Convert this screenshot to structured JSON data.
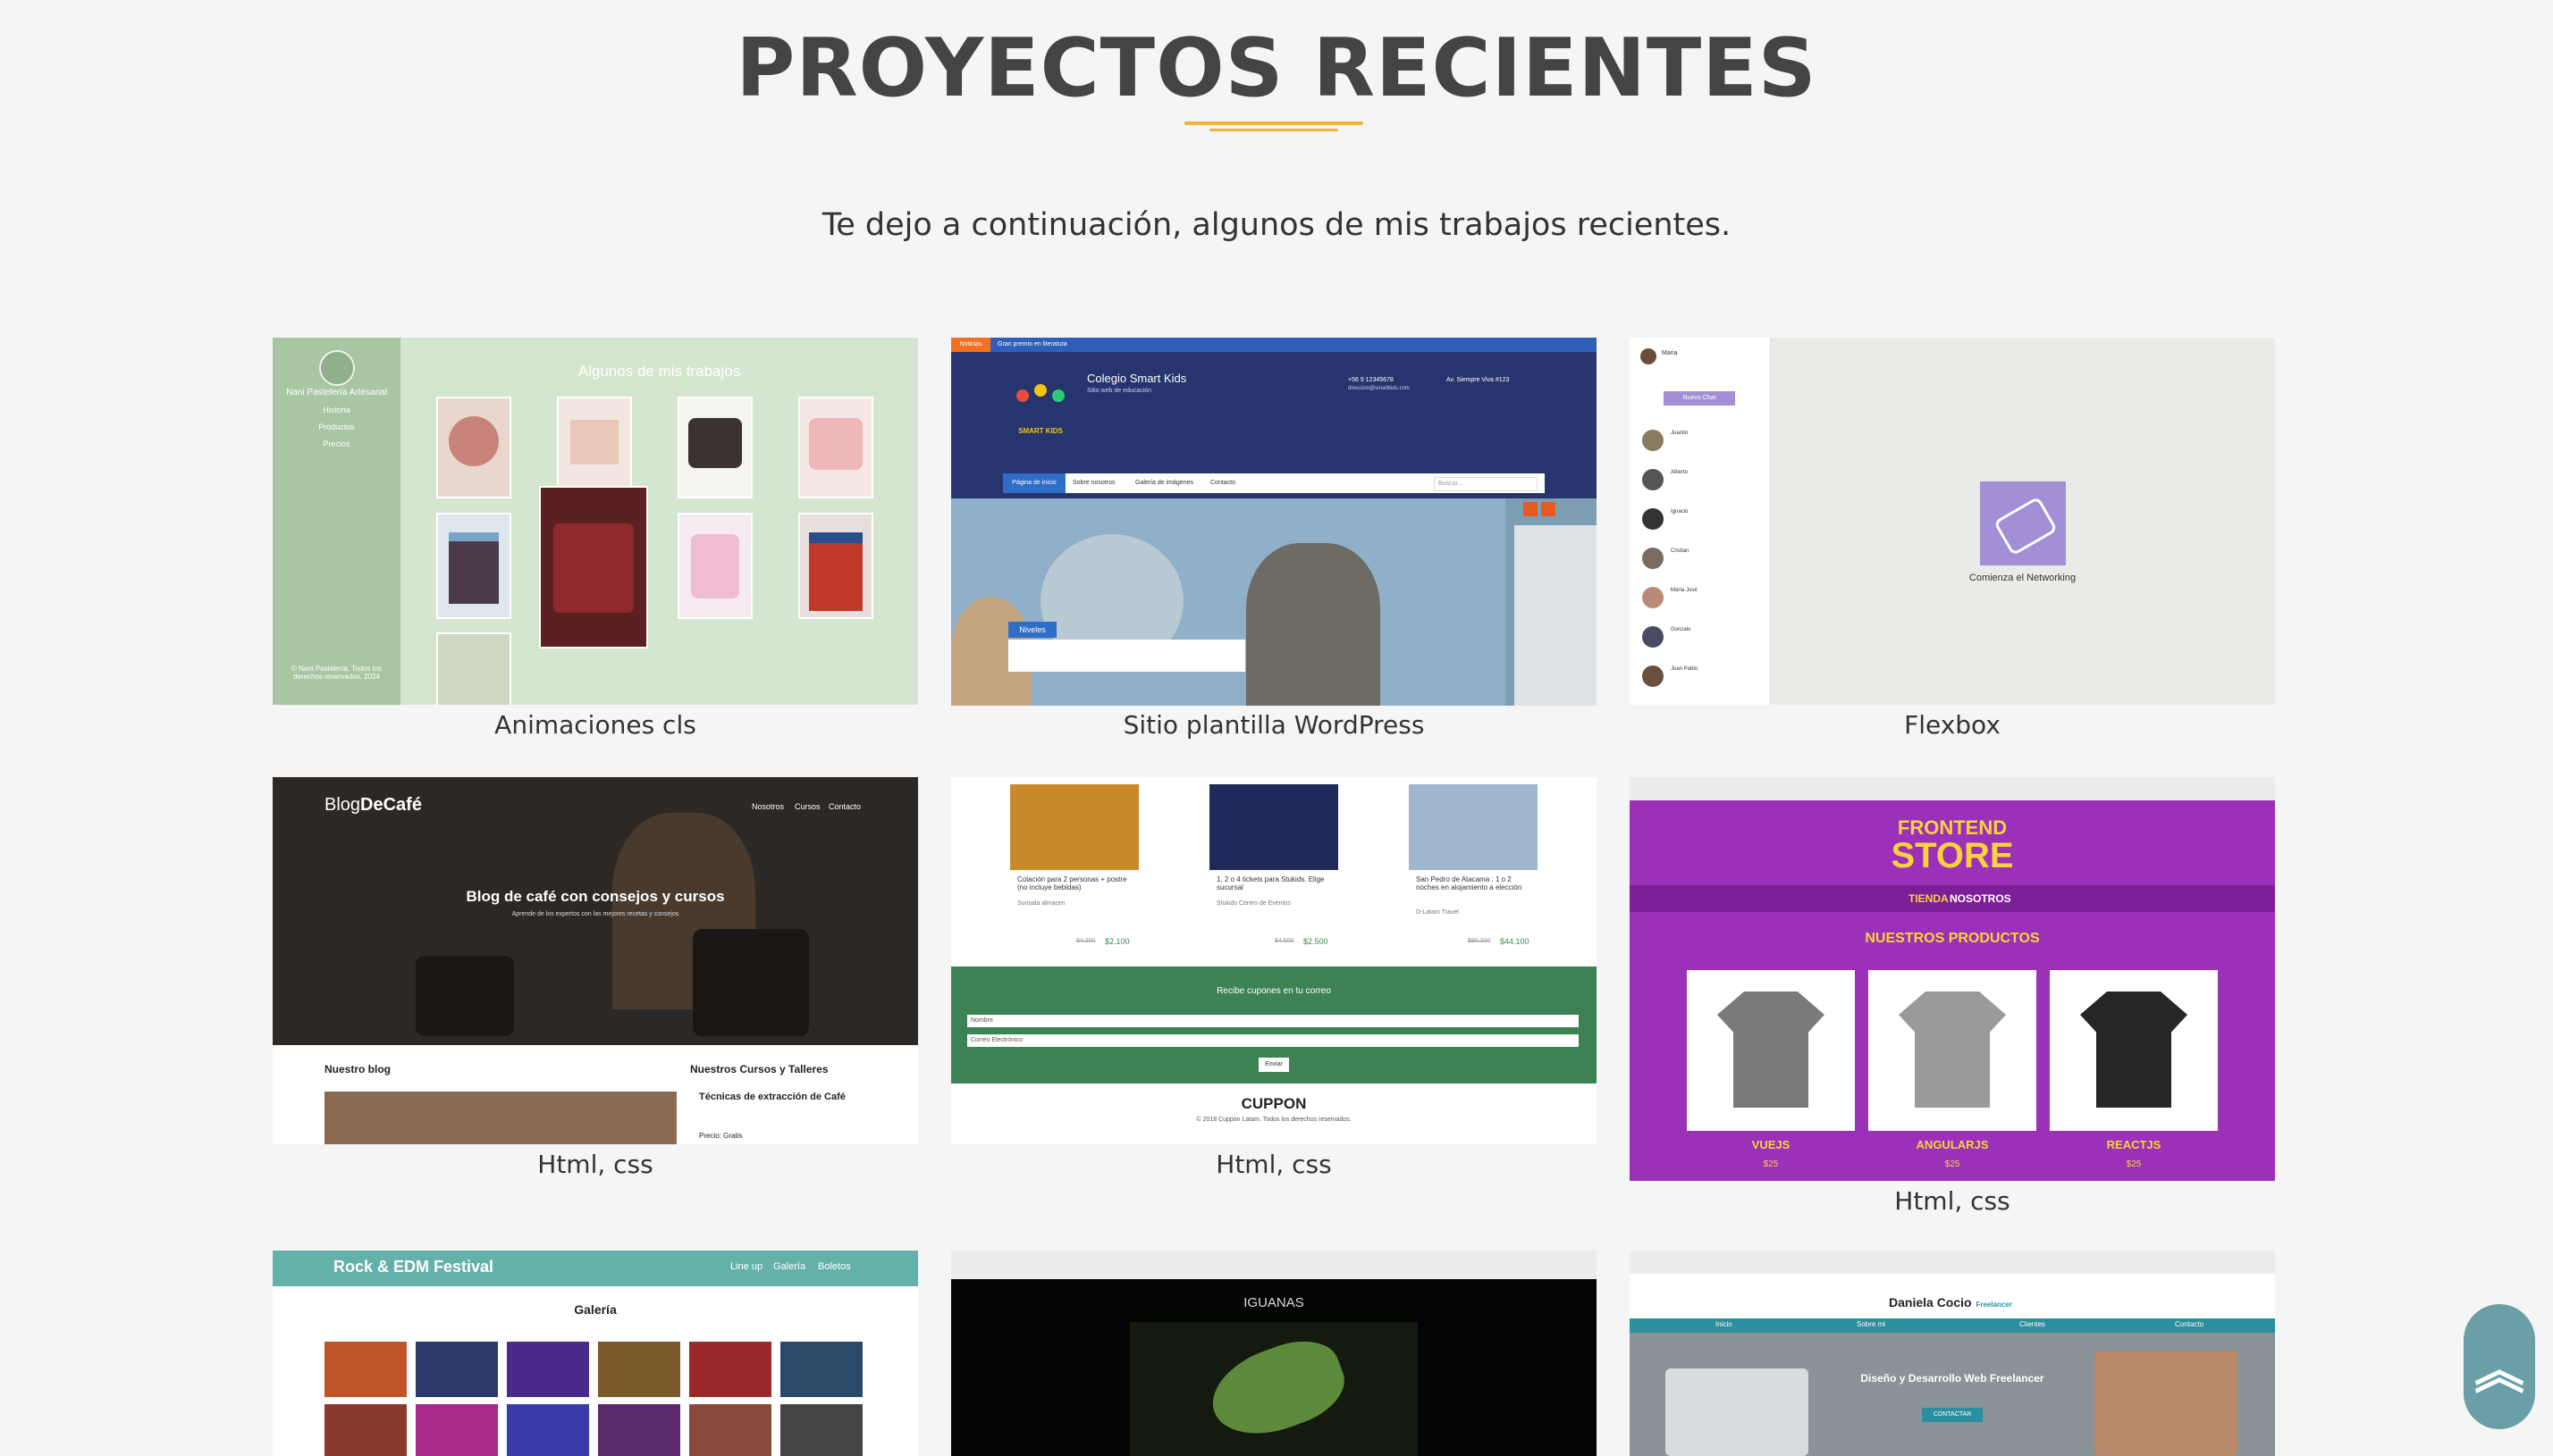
{
  "section": {
    "title": "PROYECTOS RECIENTES",
    "subtitle": "Te dejo a continuación, algunos de mis trabajos recientes."
  },
  "projects": [
    {
      "caption": "Animaciones cls",
      "thumb": {
        "sidebar_name": "Nani Pastelería Artesanal",
        "menu": [
          "Historia",
          "Productos",
          "Precios"
        ],
        "heading": "Algunos de mis trabajos",
        "footer": "© Nani Pastelería. Todos los derechos reservados. 2024"
      }
    },
    {
      "caption": "Sitio plantilla WordPress",
      "thumb": {
        "topbar": [
          "Noticias",
          "Gran premio en literatura"
        ],
        "brand": "Colegio Smart Kids",
        "tagline": "Sitio web de educación",
        "logo_text": "SMART KIDS",
        "phone": "+56 9 12345678",
        "email": "direccion@smartkids.com",
        "address": "Av. Siempre Viva #123",
        "nav": [
          "Página de inicio",
          "Sobre nosotros",
          "Galería de imágenes",
          "Contacto"
        ],
        "search": "Buscar...",
        "tag": "Niveles"
      }
    },
    {
      "caption": "Flexbox",
      "thumb": {
        "user": "Maria",
        "button": "Nuevo Chat",
        "contacts": [
          "Juanito",
          "Alberto",
          "Ignacio",
          "Cristian",
          "María José",
          "Gonzalo",
          "Juan Pablo"
        ],
        "center_title": "Comienza el Networking"
      }
    },
    {
      "caption": "Html, css",
      "thumb": {
        "logo_a": "Blog",
        "logo_b": "DeCafé",
        "nav": [
          "Nosotros",
          "Cursos",
          "Contacto"
        ],
        "hero": "Blog de café con consejos y cursos",
        "hero_sub": "Aprende de los expertos con las mejores recetas y consejos",
        "blog": "Nuestro blog",
        "courses": "Nuestros Cursos y Talleres",
        "course_title": "Técnicas de extracción de Café",
        "price": "Precio: Gratis"
      }
    },
    {
      "caption": "Html, css",
      "thumb": {
        "offers": [
          {
            "text": "Colación para 2 personas + postre (no incluye bebidas)",
            "place": "Sunsala almacen",
            "old": "$4.200",
            "new": "$2.100"
          },
          {
            "text": "1, 2 o 4 tickets para Stukids. Elige sucursal",
            "place": "Stukids Centro de Eventos",
            "old": "$4.500",
            "new": "$2.500"
          },
          {
            "text": "San Pedro de Atacama : 1 o 2 noches en alojamiento a elección",
            "place": "D-Latam Travel",
            "old": "$80.200",
            "new": "$44.100"
          }
        ],
        "newsletter": "Recibe cupones en tu correo",
        "name_ph": "Nombre",
        "email_ph": "Correo Electrónico",
        "send": "Enviar",
        "brand": "CUPPON",
        "copy": "© 2018 Cuppon Latam. Todos los derechos reservados."
      }
    },
    {
      "caption": "Html, css",
      "thumb": {
        "brand_a": "FRONTEND",
        "brand_b": "STORE",
        "nav": [
          "TIENDA",
          "NOSOTROS"
        ],
        "heading": "NUESTROS PRODUCTOS",
        "products": [
          {
            "name": "VUEJS",
            "price": "$25"
          },
          {
            "name": "ANGULARJS",
            "price": "$25"
          },
          {
            "name": "REACTJS",
            "price": "$25"
          }
        ]
      }
    },
    {
      "caption": "",
      "thumb": {
        "brand": "Rock & EDM Festival",
        "nav": [
          "Line up",
          "Galería",
          "Boletos"
        ],
        "heading": "Galería"
      }
    },
    {
      "caption": "",
      "thumb": {
        "heading": "IGUANAS"
      }
    },
    {
      "caption": "",
      "thumb": {
        "name": "Daniela Cocio",
        "badge": "Freelancer",
        "nav": [
          "Inicio",
          "Sobre mi",
          "Clientes",
          "Contacto"
        ],
        "hero": "Diseño y Desarrollo Web Freelancer",
        "cta": "CONTACTAR"
      }
    }
  ],
  "colors": {
    "accent": "#f0b437",
    "scroll_button": "#6a9fa8",
    "title": "#444444"
  },
  "scroll_top": {
    "icon": "double-chevron-up-icon"
  }
}
